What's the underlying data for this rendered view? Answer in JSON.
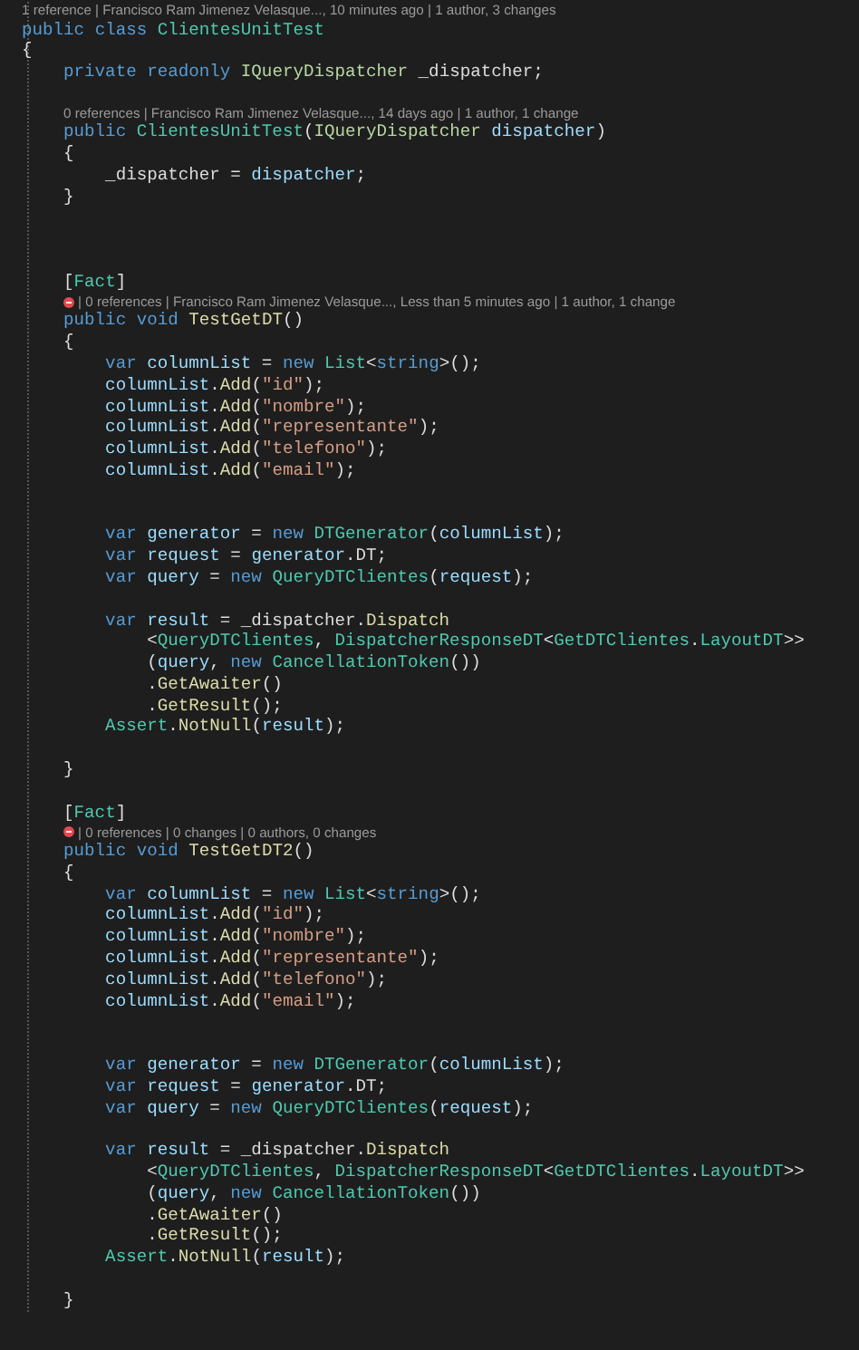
{
  "lines": [
    {
      "kind": "lens",
      "text": "1 reference | Francisco Ram Jimenez Velasque..., 10 minutes ago | 1 author, 3 changes",
      "failed": false
    },
    {
      "kind": "code",
      "tokens": [
        {
          "text": "public ",
          "kind": "kw"
        },
        {
          "text": "class ",
          "kind": "kw"
        },
        {
          "text": "ClientesUnitTest",
          "kind": "type"
        }
      ]
    },
    {
      "kind": "code",
      "tokens": [
        {
          "text": "{",
          "kind": "plain"
        }
      ]
    },
    {
      "kind": "code",
      "tokens": [
        {
          "text": "    private ",
          "kind": "kw"
        },
        {
          "text": "readonly ",
          "kind": "kw"
        },
        {
          "text": "IQueryDispatcher",
          "kind": "iface"
        },
        {
          "text": " _dispatcher;",
          "kind": "plain"
        }
      ]
    },
    {
      "kind": "blank"
    },
    {
      "kind": "lens",
      "text": "0 references | Francisco Ram Jimenez Velasque..., 14 days ago | 1 author, 1 change",
      "failed": false
    },
    {
      "kind": "code",
      "tokens": [
        {
          "text": "    public ",
          "kind": "kw"
        },
        {
          "text": "ClientesUnitTest",
          "kind": "type"
        },
        {
          "text": "(",
          "kind": "plain"
        },
        {
          "text": "IQueryDispatcher",
          "kind": "iface"
        },
        {
          "text": " dispatcher",
          "kind": "var"
        },
        {
          "text": ")",
          "kind": "plain"
        }
      ]
    },
    {
      "kind": "code",
      "tokens": [
        {
          "text": "    {",
          "kind": "plain"
        }
      ]
    },
    {
      "kind": "code",
      "tokens": [
        {
          "text": "        _dispatcher = ",
          "kind": "plain"
        },
        {
          "text": "dispatcher",
          "kind": "var"
        },
        {
          "text": ";",
          "kind": "plain"
        }
      ]
    },
    {
      "kind": "code",
      "tokens": [
        {
          "text": "    }",
          "kind": "plain"
        }
      ]
    },
    {
      "kind": "blank"
    },
    {
      "kind": "blank"
    },
    {
      "kind": "blank"
    },
    {
      "kind": "code",
      "tokens": [
        {
          "text": "    [",
          "kind": "plain"
        },
        {
          "text": "Fact",
          "kind": "type"
        },
        {
          "text": "]",
          "kind": "plain"
        }
      ]
    },
    {
      "kind": "lens",
      "text": "| 0 references | Francisco Ram Jimenez Velasque..., Less than 5 minutes ago | 1 author, 1 change",
      "failed": true
    },
    {
      "kind": "code",
      "tokens": [
        {
          "text": "    public ",
          "kind": "kw"
        },
        {
          "text": "void ",
          "kind": "kw"
        },
        {
          "text": "TestGetDT",
          "kind": "method"
        },
        {
          "text": "()",
          "kind": "plain"
        }
      ]
    },
    {
      "kind": "code",
      "tokens": [
        {
          "text": "    {",
          "kind": "plain"
        }
      ]
    },
    {
      "kind": "code",
      "tokens": [
        {
          "text": "        var ",
          "kind": "kw"
        },
        {
          "text": "columnList",
          "kind": "var"
        },
        {
          "text": " = ",
          "kind": "plain"
        },
        {
          "text": "new ",
          "kind": "kw"
        },
        {
          "text": "List",
          "kind": "type"
        },
        {
          "text": "<",
          "kind": "plain"
        },
        {
          "text": "string",
          "kind": "kw"
        },
        {
          "text": ">();",
          "kind": "plain"
        }
      ]
    },
    {
      "kind": "code",
      "tokens": [
        {
          "text": "        columnList",
          "kind": "var"
        },
        {
          "text": ".",
          "kind": "plain"
        },
        {
          "text": "Add",
          "kind": "method"
        },
        {
          "text": "(",
          "kind": "plain"
        },
        {
          "text": "\"id\"",
          "kind": "str"
        },
        {
          "text": ");",
          "kind": "plain"
        }
      ]
    },
    {
      "kind": "code",
      "tokens": [
        {
          "text": "        columnList",
          "kind": "var"
        },
        {
          "text": ".",
          "kind": "plain"
        },
        {
          "text": "Add",
          "kind": "method"
        },
        {
          "text": "(",
          "kind": "plain"
        },
        {
          "text": "\"nombre\"",
          "kind": "str"
        },
        {
          "text": ");",
          "kind": "plain"
        }
      ]
    },
    {
      "kind": "code",
      "tokens": [
        {
          "text": "        columnList",
          "kind": "var"
        },
        {
          "text": ".",
          "kind": "plain"
        },
        {
          "text": "Add",
          "kind": "method"
        },
        {
          "text": "(",
          "kind": "plain"
        },
        {
          "text": "\"representante\"",
          "kind": "str"
        },
        {
          "text": ");",
          "kind": "plain"
        }
      ]
    },
    {
      "kind": "code",
      "tokens": [
        {
          "text": "        columnList",
          "kind": "var"
        },
        {
          "text": ".",
          "kind": "plain"
        },
        {
          "text": "Add",
          "kind": "method"
        },
        {
          "text": "(",
          "kind": "plain"
        },
        {
          "text": "\"telefono\"",
          "kind": "str"
        },
        {
          "text": ");",
          "kind": "plain"
        }
      ]
    },
    {
      "kind": "code",
      "tokens": [
        {
          "text": "        columnList",
          "kind": "var"
        },
        {
          "text": ".",
          "kind": "plain"
        },
        {
          "text": "Add",
          "kind": "method"
        },
        {
          "text": "(",
          "kind": "plain"
        },
        {
          "text": "\"email\"",
          "kind": "str"
        },
        {
          "text": ");",
          "kind": "plain"
        }
      ]
    },
    {
      "kind": "blank"
    },
    {
      "kind": "blank"
    },
    {
      "kind": "code",
      "tokens": [
        {
          "text": "        var ",
          "kind": "kw"
        },
        {
          "text": "generator",
          "kind": "var"
        },
        {
          "text": " = ",
          "kind": "plain"
        },
        {
          "text": "new ",
          "kind": "kw"
        },
        {
          "text": "DTGenerator",
          "kind": "type"
        },
        {
          "text": "(",
          "kind": "plain"
        },
        {
          "text": "columnList",
          "kind": "var"
        },
        {
          "text": ");",
          "kind": "plain"
        }
      ]
    },
    {
      "kind": "code",
      "tokens": [
        {
          "text": "        var ",
          "kind": "kw"
        },
        {
          "text": "request",
          "kind": "var"
        },
        {
          "text": " = ",
          "kind": "plain"
        },
        {
          "text": "generator",
          "kind": "var"
        },
        {
          "text": ".DT;",
          "kind": "plain"
        }
      ]
    },
    {
      "kind": "code",
      "tokens": [
        {
          "text": "        var ",
          "kind": "kw"
        },
        {
          "text": "query",
          "kind": "var"
        },
        {
          "text": " = ",
          "kind": "plain"
        },
        {
          "text": "new ",
          "kind": "kw"
        },
        {
          "text": "QueryDTClientes",
          "kind": "type"
        },
        {
          "text": "(",
          "kind": "plain"
        },
        {
          "text": "request",
          "kind": "var"
        },
        {
          "text": ");",
          "kind": "plain"
        }
      ]
    },
    {
      "kind": "blank"
    },
    {
      "kind": "code",
      "tokens": [
        {
          "text": "        var ",
          "kind": "kw"
        },
        {
          "text": "result",
          "kind": "var"
        },
        {
          "text": " = _dispatcher.",
          "kind": "plain"
        },
        {
          "text": "Dispatch",
          "kind": "method"
        }
      ]
    },
    {
      "kind": "code",
      "tokens": [
        {
          "text": "            <",
          "kind": "plain"
        },
        {
          "text": "QueryDTClientes",
          "kind": "type"
        },
        {
          "text": ", ",
          "kind": "plain"
        },
        {
          "text": "DispatcherResponseDT",
          "kind": "type"
        },
        {
          "text": "<",
          "kind": "plain"
        },
        {
          "text": "GetDTClientes",
          "kind": "type"
        },
        {
          "text": ".",
          "kind": "plain"
        },
        {
          "text": "LayoutDT",
          "kind": "type"
        },
        {
          "text": ">>",
          "kind": "plain"
        }
      ]
    },
    {
      "kind": "code",
      "tokens": [
        {
          "text": "            (",
          "kind": "plain"
        },
        {
          "text": "query",
          "kind": "var"
        },
        {
          "text": ", ",
          "kind": "plain"
        },
        {
          "text": "new ",
          "kind": "kw"
        },
        {
          "text": "CancellationToken",
          "kind": "type"
        },
        {
          "text": "())",
          "kind": "plain"
        }
      ]
    },
    {
      "kind": "code",
      "tokens": [
        {
          "text": "            .",
          "kind": "plain"
        },
        {
          "text": "GetAwaiter",
          "kind": "method"
        },
        {
          "text": "()",
          "kind": "plain"
        }
      ]
    },
    {
      "kind": "code",
      "tokens": [
        {
          "text": "            .",
          "kind": "plain"
        },
        {
          "text": "GetResult",
          "kind": "method"
        },
        {
          "text": "();",
          "kind": "plain"
        }
      ]
    },
    {
      "kind": "code",
      "tokens": [
        {
          "text": "        Assert",
          "kind": "type"
        },
        {
          "text": ".",
          "kind": "plain"
        },
        {
          "text": "NotNull",
          "kind": "method"
        },
        {
          "text": "(",
          "kind": "plain"
        },
        {
          "text": "result",
          "kind": "var"
        },
        {
          "text": ");",
          "kind": "plain"
        }
      ]
    },
    {
      "kind": "blank"
    },
    {
      "kind": "code",
      "tokens": [
        {
          "text": "    }",
          "kind": "plain"
        }
      ]
    },
    {
      "kind": "blank"
    },
    {
      "kind": "code",
      "tokens": [
        {
          "text": "    [",
          "kind": "plain"
        },
        {
          "text": "Fact",
          "kind": "type"
        },
        {
          "text": "]",
          "kind": "plain"
        }
      ]
    },
    {
      "kind": "lens",
      "text": "| 0 references | 0 changes | 0 authors, 0 changes",
      "failed": true
    },
    {
      "kind": "code",
      "tokens": [
        {
          "text": "    public ",
          "kind": "kw"
        },
        {
          "text": "void ",
          "kind": "kw"
        },
        {
          "text": "TestGetDT2",
          "kind": "method"
        },
        {
          "text": "()",
          "kind": "plain"
        }
      ]
    },
    {
      "kind": "code",
      "tokens": [
        {
          "text": "    {",
          "kind": "plain"
        }
      ]
    },
    {
      "kind": "code",
      "tokens": [
        {
          "text": "        var ",
          "kind": "kw"
        },
        {
          "text": "columnList",
          "kind": "var"
        },
        {
          "text": " = ",
          "kind": "plain"
        },
        {
          "text": "new ",
          "kind": "kw"
        },
        {
          "text": "List",
          "kind": "type"
        },
        {
          "text": "<",
          "kind": "plain"
        },
        {
          "text": "string",
          "kind": "kw"
        },
        {
          "text": ">();",
          "kind": "plain"
        }
      ]
    },
    {
      "kind": "code",
      "tokens": [
        {
          "text": "        columnList",
          "kind": "var"
        },
        {
          "text": ".",
          "kind": "plain"
        },
        {
          "text": "Add",
          "kind": "method"
        },
        {
          "text": "(",
          "kind": "plain"
        },
        {
          "text": "\"id\"",
          "kind": "str"
        },
        {
          "text": ");",
          "kind": "plain"
        }
      ]
    },
    {
      "kind": "code",
      "tokens": [
        {
          "text": "        columnList",
          "kind": "var"
        },
        {
          "text": ".",
          "kind": "plain"
        },
        {
          "text": "Add",
          "kind": "method"
        },
        {
          "text": "(",
          "kind": "plain"
        },
        {
          "text": "\"nombre\"",
          "kind": "str"
        },
        {
          "text": ");",
          "kind": "plain"
        }
      ]
    },
    {
      "kind": "code",
      "tokens": [
        {
          "text": "        columnList",
          "kind": "var"
        },
        {
          "text": ".",
          "kind": "plain"
        },
        {
          "text": "Add",
          "kind": "method"
        },
        {
          "text": "(",
          "kind": "plain"
        },
        {
          "text": "\"representante\"",
          "kind": "str"
        },
        {
          "text": ");",
          "kind": "plain"
        }
      ]
    },
    {
      "kind": "code",
      "tokens": [
        {
          "text": "        columnList",
          "kind": "var"
        },
        {
          "text": ".",
          "kind": "plain"
        },
        {
          "text": "Add",
          "kind": "method"
        },
        {
          "text": "(",
          "kind": "plain"
        },
        {
          "text": "\"telefono\"",
          "kind": "str"
        },
        {
          "text": ");",
          "kind": "plain"
        }
      ]
    },
    {
      "kind": "code",
      "tokens": [
        {
          "text": "        columnList",
          "kind": "var"
        },
        {
          "text": ".",
          "kind": "plain"
        },
        {
          "text": "Add",
          "kind": "method"
        },
        {
          "text": "(",
          "kind": "plain"
        },
        {
          "text": "\"email\"",
          "kind": "str"
        },
        {
          "text": ");",
          "kind": "plain"
        }
      ]
    },
    {
      "kind": "blank"
    },
    {
      "kind": "blank"
    },
    {
      "kind": "code",
      "tokens": [
        {
          "text": "        var ",
          "kind": "kw"
        },
        {
          "text": "generator",
          "kind": "var"
        },
        {
          "text": " = ",
          "kind": "plain"
        },
        {
          "text": "new ",
          "kind": "kw"
        },
        {
          "text": "DTGenerator",
          "kind": "type"
        },
        {
          "text": "(",
          "kind": "plain"
        },
        {
          "text": "columnList",
          "kind": "var"
        },
        {
          "text": ");",
          "kind": "plain"
        }
      ]
    },
    {
      "kind": "code",
      "tokens": [
        {
          "text": "        var ",
          "kind": "kw"
        },
        {
          "text": "request",
          "kind": "var"
        },
        {
          "text": " = ",
          "kind": "plain"
        },
        {
          "text": "generator",
          "kind": "var"
        },
        {
          "text": ".DT;",
          "kind": "plain"
        }
      ]
    },
    {
      "kind": "code",
      "tokens": [
        {
          "text": "        var ",
          "kind": "kw"
        },
        {
          "text": "query",
          "kind": "var"
        },
        {
          "text": " = ",
          "kind": "plain"
        },
        {
          "text": "new ",
          "kind": "kw"
        },
        {
          "text": "QueryDTClientes",
          "kind": "type"
        },
        {
          "text": "(",
          "kind": "plain"
        },
        {
          "text": "request",
          "kind": "var"
        },
        {
          "text": ");",
          "kind": "plain"
        }
      ]
    },
    {
      "kind": "blank"
    },
    {
      "kind": "code",
      "tokens": [
        {
          "text": "        var ",
          "kind": "kw"
        },
        {
          "text": "result",
          "kind": "var"
        },
        {
          "text": " = _dispatcher.",
          "kind": "plain"
        },
        {
          "text": "Dispatch",
          "kind": "method"
        }
      ]
    },
    {
      "kind": "code",
      "tokens": [
        {
          "text": "            <",
          "kind": "plain"
        },
        {
          "text": "QueryDTClientes",
          "kind": "type"
        },
        {
          "text": ", ",
          "kind": "plain"
        },
        {
          "text": "DispatcherResponseDT",
          "kind": "type"
        },
        {
          "text": "<",
          "kind": "plain"
        },
        {
          "text": "GetDTClientes",
          "kind": "type"
        },
        {
          "text": ".",
          "kind": "plain"
        },
        {
          "text": "LayoutDT",
          "kind": "type"
        },
        {
          "text": ">>",
          "kind": "plain"
        }
      ]
    },
    {
      "kind": "code",
      "tokens": [
        {
          "text": "            (",
          "kind": "plain"
        },
        {
          "text": "query",
          "kind": "var"
        },
        {
          "text": ", ",
          "kind": "plain"
        },
        {
          "text": "new ",
          "kind": "kw"
        },
        {
          "text": "CancellationToken",
          "kind": "type"
        },
        {
          "text": "())",
          "kind": "plain"
        }
      ]
    },
    {
      "kind": "code",
      "tokens": [
        {
          "text": "            .",
          "kind": "plain"
        },
        {
          "text": "GetAwaiter",
          "kind": "method"
        },
        {
          "text": "()",
          "kind": "plain"
        }
      ]
    },
    {
      "kind": "code",
      "tokens": [
        {
          "text": "            .",
          "kind": "plain"
        },
        {
          "text": "GetResult",
          "kind": "method"
        },
        {
          "text": "();",
          "kind": "plain"
        }
      ]
    },
    {
      "kind": "code",
      "tokens": [
        {
          "text": "        Assert",
          "kind": "type"
        },
        {
          "text": ".",
          "kind": "plain"
        },
        {
          "text": "NotNull",
          "kind": "method"
        },
        {
          "text": "(",
          "kind": "plain"
        },
        {
          "text": "result",
          "kind": "var"
        },
        {
          "text": ");",
          "kind": "plain"
        }
      ]
    },
    {
      "kind": "blank"
    },
    {
      "kind": "code",
      "tokens": [
        {
          "text": "    }",
          "kind": "plain"
        }
      ]
    }
  ]
}
